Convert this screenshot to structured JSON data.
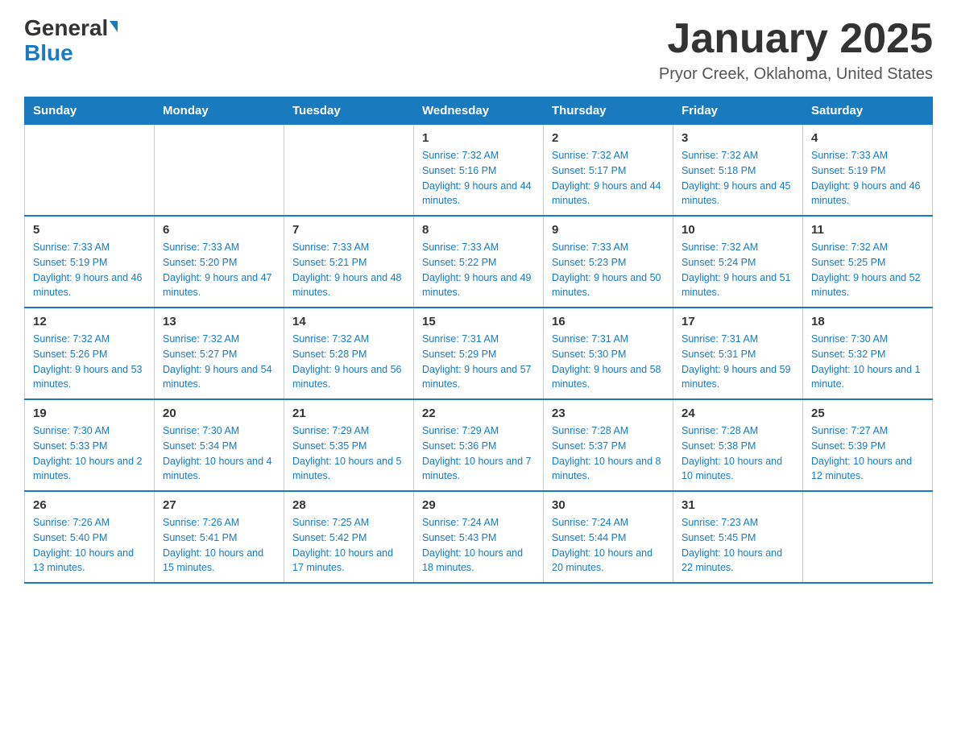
{
  "logo": {
    "general": "General",
    "blue": "Blue"
  },
  "title": "January 2025",
  "subtitle": "Pryor Creek, Oklahoma, United States",
  "days_of_week": [
    "Sunday",
    "Monday",
    "Tuesday",
    "Wednesday",
    "Thursday",
    "Friday",
    "Saturday"
  ],
  "weeks": [
    [
      {
        "day": "",
        "sunrise": "",
        "sunset": "",
        "daylight": ""
      },
      {
        "day": "",
        "sunrise": "",
        "sunset": "",
        "daylight": ""
      },
      {
        "day": "",
        "sunrise": "",
        "sunset": "",
        "daylight": ""
      },
      {
        "day": "1",
        "sunrise": "Sunrise: 7:32 AM",
        "sunset": "Sunset: 5:16 PM",
        "daylight": "Daylight: 9 hours and 44 minutes."
      },
      {
        "day": "2",
        "sunrise": "Sunrise: 7:32 AM",
        "sunset": "Sunset: 5:17 PM",
        "daylight": "Daylight: 9 hours and 44 minutes."
      },
      {
        "day": "3",
        "sunrise": "Sunrise: 7:32 AM",
        "sunset": "Sunset: 5:18 PM",
        "daylight": "Daylight: 9 hours and 45 minutes."
      },
      {
        "day": "4",
        "sunrise": "Sunrise: 7:33 AM",
        "sunset": "Sunset: 5:19 PM",
        "daylight": "Daylight: 9 hours and 46 minutes."
      }
    ],
    [
      {
        "day": "5",
        "sunrise": "Sunrise: 7:33 AM",
        "sunset": "Sunset: 5:19 PM",
        "daylight": "Daylight: 9 hours and 46 minutes."
      },
      {
        "day": "6",
        "sunrise": "Sunrise: 7:33 AM",
        "sunset": "Sunset: 5:20 PM",
        "daylight": "Daylight: 9 hours and 47 minutes."
      },
      {
        "day": "7",
        "sunrise": "Sunrise: 7:33 AM",
        "sunset": "Sunset: 5:21 PM",
        "daylight": "Daylight: 9 hours and 48 minutes."
      },
      {
        "day": "8",
        "sunrise": "Sunrise: 7:33 AM",
        "sunset": "Sunset: 5:22 PM",
        "daylight": "Daylight: 9 hours and 49 minutes."
      },
      {
        "day": "9",
        "sunrise": "Sunrise: 7:33 AM",
        "sunset": "Sunset: 5:23 PM",
        "daylight": "Daylight: 9 hours and 50 minutes."
      },
      {
        "day": "10",
        "sunrise": "Sunrise: 7:32 AM",
        "sunset": "Sunset: 5:24 PM",
        "daylight": "Daylight: 9 hours and 51 minutes."
      },
      {
        "day": "11",
        "sunrise": "Sunrise: 7:32 AM",
        "sunset": "Sunset: 5:25 PM",
        "daylight": "Daylight: 9 hours and 52 minutes."
      }
    ],
    [
      {
        "day": "12",
        "sunrise": "Sunrise: 7:32 AM",
        "sunset": "Sunset: 5:26 PM",
        "daylight": "Daylight: 9 hours and 53 minutes."
      },
      {
        "day": "13",
        "sunrise": "Sunrise: 7:32 AM",
        "sunset": "Sunset: 5:27 PM",
        "daylight": "Daylight: 9 hours and 54 minutes."
      },
      {
        "day": "14",
        "sunrise": "Sunrise: 7:32 AM",
        "sunset": "Sunset: 5:28 PM",
        "daylight": "Daylight: 9 hours and 56 minutes."
      },
      {
        "day": "15",
        "sunrise": "Sunrise: 7:31 AM",
        "sunset": "Sunset: 5:29 PM",
        "daylight": "Daylight: 9 hours and 57 minutes."
      },
      {
        "day": "16",
        "sunrise": "Sunrise: 7:31 AM",
        "sunset": "Sunset: 5:30 PM",
        "daylight": "Daylight: 9 hours and 58 minutes."
      },
      {
        "day": "17",
        "sunrise": "Sunrise: 7:31 AM",
        "sunset": "Sunset: 5:31 PM",
        "daylight": "Daylight: 9 hours and 59 minutes."
      },
      {
        "day": "18",
        "sunrise": "Sunrise: 7:30 AM",
        "sunset": "Sunset: 5:32 PM",
        "daylight": "Daylight: 10 hours and 1 minute."
      }
    ],
    [
      {
        "day": "19",
        "sunrise": "Sunrise: 7:30 AM",
        "sunset": "Sunset: 5:33 PM",
        "daylight": "Daylight: 10 hours and 2 minutes."
      },
      {
        "day": "20",
        "sunrise": "Sunrise: 7:30 AM",
        "sunset": "Sunset: 5:34 PM",
        "daylight": "Daylight: 10 hours and 4 minutes."
      },
      {
        "day": "21",
        "sunrise": "Sunrise: 7:29 AM",
        "sunset": "Sunset: 5:35 PM",
        "daylight": "Daylight: 10 hours and 5 minutes."
      },
      {
        "day": "22",
        "sunrise": "Sunrise: 7:29 AM",
        "sunset": "Sunset: 5:36 PM",
        "daylight": "Daylight: 10 hours and 7 minutes."
      },
      {
        "day": "23",
        "sunrise": "Sunrise: 7:28 AM",
        "sunset": "Sunset: 5:37 PM",
        "daylight": "Daylight: 10 hours and 8 minutes."
      },
      {
        "day": "24",
        "sunrise": "Sunrise: 7:28 AM",
        "sunset": "Sunset: 5:38 PM",
        "daylight": "Daylight: 10 hours and 10 minutes."
      },
      {
        "day": "25",
        "sunrise": "Sunrise: 7:27 AM",
        "sunset": "Sunset: 5:39 PM",
        "daylight": "Daylight: 10 hours and 12 minutes."
      }
    ],
    [
      {
        "day": "26",
        "sunrise": "Sunrise: 7:26 AM",
        "sunset": "Sunset: 5:40 PM",
        "daylight": "Daylight: 10 hours and 13 minutes."
      },
      {
        "day": "27",
        "sunrise": "Sunrise: 7:26 AM",
        "sunset": "Sunset: 5:41 PM",
        "daylight": "Daylight: 10 hours and 15 minutes."
      },
      {
        "day": "28",
        "sunrise": "Sunrise: 7:25 AM",
        "sunset": "Sunset: 5:42 PM",
        "daylight": "Daylight: 10 hours and 17 minutes."
      },
      {
        "day": "29",
        "sunrise": "Sunrise: 7:24 AM",
        "sunset": "Sunset: 5:43 PM",
        "daylight": "Daylight: 10 hours and 18 minutes."
      },
      {
        "day": "30",
        "sunrise": "Sunrise: 7:24 AM",
        "sunset": "Sunset: 5:44 PM",
        "daylight": "Daylight: 10 hours and 20 minutes."
      },
      {
        "day": "31",
        "sunrise": "Sunrise: 7:23 AM",
        "sunset": "Sunset: 5:45 PM",
        "daylight": "Daylight: 10 hours and 22 minutes."
      },
      {
        "day": "",
        "sunrise": "",
        "sunset": "",
        "daylight": ""
      }
    ]
  ]
}
